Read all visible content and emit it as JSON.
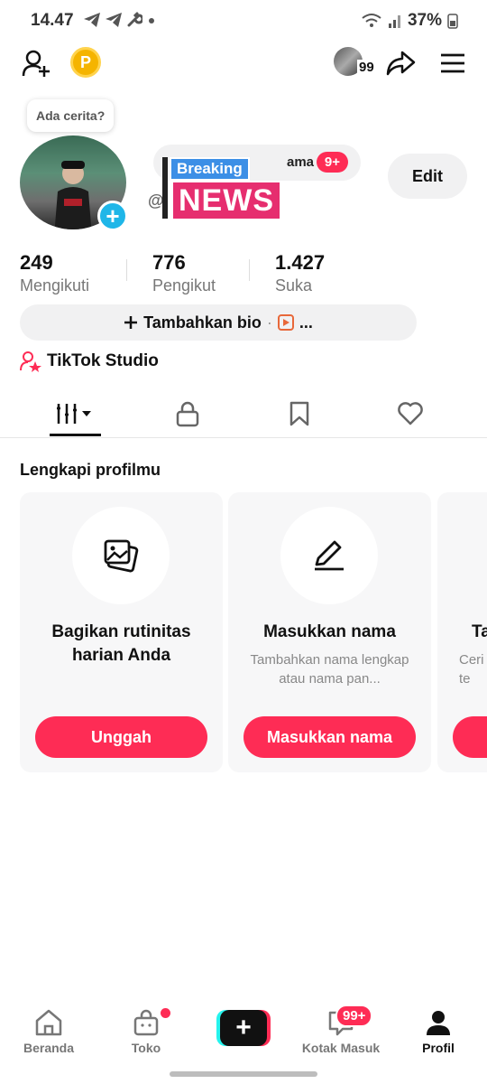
{
  "status_bar": {
    "time": "14.47",
    "battery": "37%",
    "left_icons": [
      "telegram-icon",
      "telegram-icon",
      "wrench-icon",
      "dot-icon"
    ],
    "right_icons": [
      "wifi-icon",
      "signal-icon",
      "battery-icon"
    ]
  },
  "top_bar": {
    "add_friend_icon": "add-user-icon",
    "coin_label": "P",
    "mini_avatar_count": "99",
    "share_icon": "share-icon",
    "menu_icon": "hamburger-menu-icon"
  },
  "profile": {
    "story_prompt": "Ada cerita?",
    "name_partial": "ama",
    "name_badge": "9+",
    "username_prefix": "@",
    "sticker_top": "Breaking",
    "sticker_bottom": "NEWS",
    "edit_label": "Edit"
  },
  "stats": [
    {
      "value": "249",
      "label": "Mengikuti"
    },
    {
      "value": "776",
      "label": "Pengikut"
    },
    {
      "value": "1.427",
      "label": "Suka"
    }
  ],
  "bio": {
    "add_label": "Tambahkan bio",
    "separator": "·",
    "more": "..."
  },
  "studio_label": "TikTok Studio",
  "tabs": [
    "videos-grid-icon",
    "lock-icon",
    "bookmark-icon",
    "heart-icon"
  ],
  "complete_profile": {
    "title": "Lengkapi profilmu",
    "cards": [
      {
        "icon": "photos-icon",
        "title": "Bagikan rutinitas harian Anda",
        "desc": "",
        "button": "Unggah"
      },
      {
        "icon": "pencil-icon",
        "title": "Masukkan nama",
        "desc": "Tambahkan nama lengkap atau nama pan...",
        "button": "Masukkan nama"
      },
      {
        "icon": "",
        "title": "Ta",
        "desc": "Ceri te",
        "button": ""
      }
    ]
  },
  "bottom_nav": {
    "items": [
      {
        "label": "Beranda",
        "icon": "home-icon"
      },
      {
        "label": "Toko",
        "icon": "shopping-bag-icon"
      },
      {
        "label": "",
        "icon": "plus-icon"
      },
      {
        "label": "Kotak Masuk",
        "icon": "inbox-icon"
      },
      {
        "label": "Profil",
        "icon": "profile-icon"
      }
    ],
    "inbox_badge": "99+"
  },
  "colors": {
    "accent": "#fe2c55",
    "cyan": "#25f4ee",
    "plus_blue": "#1fb6e8"
  }
}
